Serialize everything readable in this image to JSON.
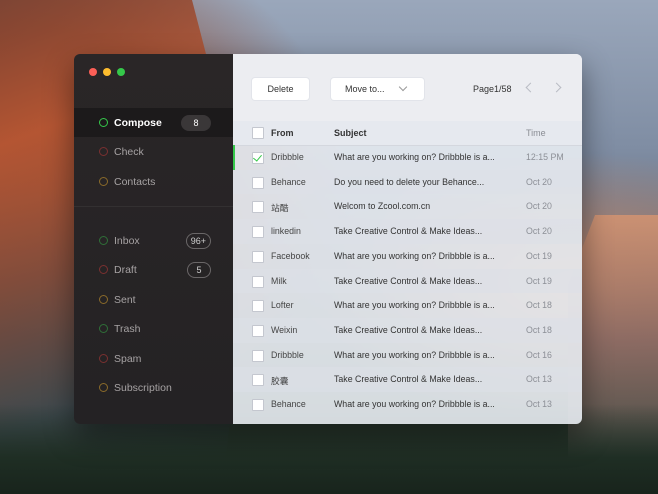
{
  "colors": {
    "accent": "#35c84a",
    "sidebar_bg": "#242224",
    "traffic_red": "#fc5f57",
    "traffic_yellow": "#fdbc2e",
    "traffic_green": "#35c84a"
  },
  "sidebar": {
    "primary": [
      {
        "label": "Compose",
        "badge": "8",
        "ring_color": "#35c84a",
        "active": true
      },
      {
        "label": "Check",
        "badge": "",
        "ring_color": "#7a3030"
      },
      {
        "label": "Contacts",
        "badge": "",
        "ring_color": "#8a6a2a"
      }
    ],
    "folders": [
      {
        "label": "Inbox",
        "badge": "96+",
        "ring_color": "#2f6f38"
      },
      {
        "label": "Draft",
        "badge": "5",
        "ring_color": "#7a3030"
      },
      {
        "label": "Sent",
        "badge": "",
        "ring_color": "#8a6a2a"
      },
      {
        "label": "Trash",
        "badge": "",
        "ring_color": "#2f6f38"
      },
      {
        "label": "Spam",
        "badge": "",
        "ring_color": "#7a3030"
      },
      {
        "label": "Subscription",
        "badge": "",
        "ring_color": "#8a6a2a"
      }
    ]
  },
  "toolbar": {
    "delete_label": "Delete",
    "move_label": "Move to...",
    "page_info": "Page1/58"
  },
  "table": {
    "headers": {
      "from": "From",
      "subject": "Subject",
      "time": "Time"
    },
    "rows": [
      {
        "from": "Dribbble",
        "subject": "What are you working on? Dribbble is a...",
        "time": "12:15 PM",
        "checked": true
      },
      {
        "from": "Behance",
        "subject": "Do you need to delete your Behance...",
        "time": "Oct 20"
      },
      {
        "from": "站酷",
        "subject": "Welcom to Zcool.com.cn",
        "time": "Oct 20"
      },
      {
        "from": "linkedin",
        "subject": "Take Creative Control & Make Ideas...",
        "time": "Oct 20"
      },
      {
        "from": "Facebook",
        "subject": "What are you working on? Dribbble is a...",
        "time": "Oct 19"
      },
      {
        "from": "Milk",
        "subject": "Take Creative Control & Make Ideas...",
        "time": "Oct 19"
      },
      {
        "from": "Lofter",
        "subject": "What are you working on? Dribbble is a...",
        "time": "Oct 18"
      },
      {
        "from": "Weixin",
        "subject": "Take Creative Control & Make Ideas...",
        "time": "Oct 18"
      },
      {
        "from": "Dribbble",
        "subject": "What are you working on? Dribbble is a...",
        "time": "Oct 16"
      },
      {
        "from": "胶囊",
        "subject": "Take Creative Control & Make Ideas...",
        "time": "Oct 13"
      },
      {
        "from": "Behance",
        "subject": "What are you working on? Dribbble is a...",
        "time": "Oct 13"
      }
    ]
  }
}
